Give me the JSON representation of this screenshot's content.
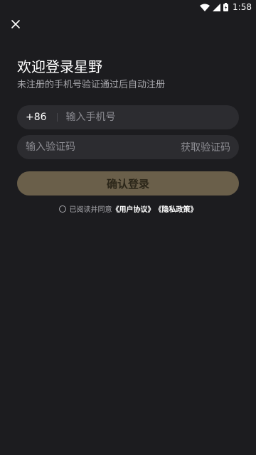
{
  "status_bar": {
    "time": "1:58",
    "icons": [
      "wifi-icon",
      "signal-icon",
      "battery-icon"
    ]
  },
  "header": {
    "close_icon": "close-icon"
  },
  "login": {
    "title": "欢迎登录星野",
    "subtitle": "未注册的手机号验证通过后自动注册",
    "phone": {
      "country_code": "+86",
      "placeholder": "输入手机号",
      "value": ""
    },
    "code": {
      "placeholder": "输入验证码",
      "value": "",
      "get_code_label": "获取验证码"
    },
    "confirm_label": "确认登录",
    "agreement": {
      "prefix": "已阅读并同意",
      "user_agreement": "《用户协议》",
      "privacy_policy": "《隐私政策》",
      "checked": false
    }
  },
  "colors": {
    "background": "#1c1c1f",
    "field": "#2c2c30",
    "button": "#6a5f4a",
    "button_text": "#2b2619"
  }
}
